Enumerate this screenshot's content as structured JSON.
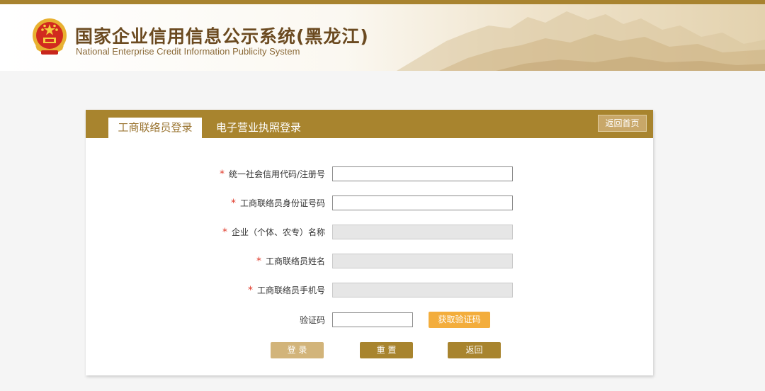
{
  "header": {
    "title_cn": "国家企业信用信息公示系统(黑龙江)",
    "title_en": "National Enterprise Credit Information Publicity System"
  },
  "tabs": [
    {
      "label": "工商联络员登录",
      "active": true
    },
    {
      "label": "电子营业执照登录",
      "active": false
    }
  ],
  "home_button": "返回首页",
  "required_mark": "*",
  "form": {
    "fields": [
      {
        "label": "统一社会信用代码/注册号",
        "value": "",
        "required": true,
        "disabled": false
      },
      {
        "label": "工商联络员身份证号码",
        "value": "",
        "required": true,
        "disabled": false
      },
      {
        "label": "企业（个体、农专）名称",
        "value": "",
        "required": true,
        "disabled": true
      },
      {
        "label": "工商联络员姓名",
        "value": "",
        "required": true,
        "disabled": true
      },
      {
        "label": "工商联络员手机号",
        "value": "",
        "required": true,
        "disabled": true
      }
    ],
    "captcha_label": "验证码",
    "captcha_value": "",
    "get_code_label": "获取验证码"
  },
  "buttons": {
    "login": "登 录",
    "reset": "重 置",
    "back": "返回"
  },
  "colors": {
    "brand": "#a8842e",
    "accent": "#f3ad3c",
    "required": "#e03c2c"
  }
}
